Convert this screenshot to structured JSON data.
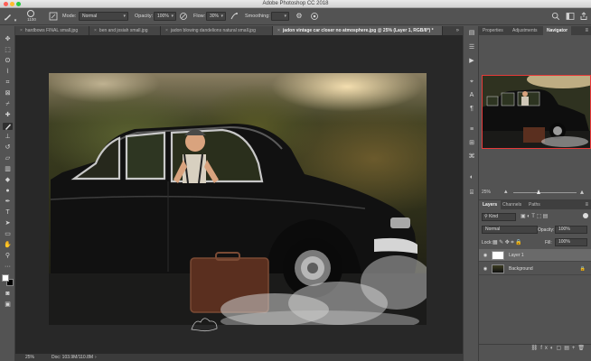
{
  "window": {
    "title": "Adobe Photoshop CC 2018"
  },
  "options_bar": {
    "brush_size": "1100",
    "mode_label": "Mode:",
    "mode_value": "Normal",
    "opacity_label": "Opacity:",
    "opacity_value": "100%",
    "flow_label": "Flow:",
    "flow_value": "30%",
    "smoothing_label": "Smoothing:"
  },
  "tabs": [
    {
      "label": "hardbows FINAL small.jpg"
    },
    {
      "label": "ben and josiah small.jpg"
    },
    {
      "label": "jadon blowing dandelions natural small.jpg"
    },
    {
      "label": "jadon vintage car closer no atmosphere.jpg @ 25% (Layer 1, RGB/8*) *"
    }
  ],
  "status": {
    "zoom": "25%",
    "doc": "Doc: 103.9M/110.8M"
  },
  "panels": {
    "top_tabs": [
      "Properties",
      "Adjustments",
      "Navigator"
    ],
    "zoom_value": "25%",
    "layers_tabs": [
      "Layers",
      "Channels",
      "Paths"
    ],
    "kind_label": "Kind",
    "blend_mode": "Normal",
    "opacity_label": "Opacity:",
    "opacity_value": "100%",
    "lock_label": "Lock:",
    "fill_label": "Fill:",
    "fill_value": "100%",
    "layers": [
      {
        "name": "Layer 1"
      },
      {
        "name": "Background"
      }
    ]
  },
  "colors": {
    "accent_nav_box": "#e53a3a",
    "canvas_bg": "#282828",
    "ui_bg": "#535353"
  }
}
